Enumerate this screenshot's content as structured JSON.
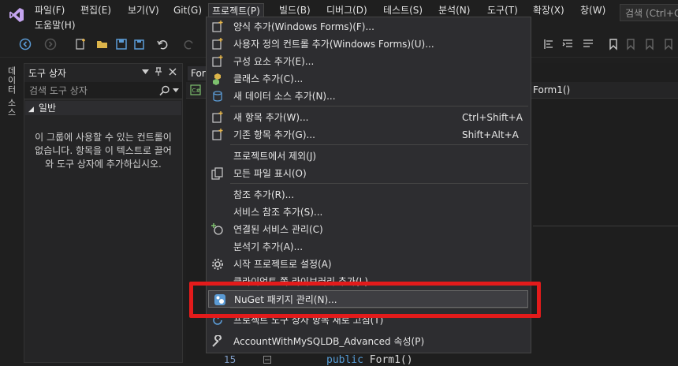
{
  "menubar": {
    "items": [
      "파일(F)",
      "편집(E)",
      "보기(V)",
      "Git(G)",
      "프로젝트(P)",
      "빌드(B)",
      "디버그(D)",
      "테스트(S)",
      "분석(N)",
      "도구(T)",
      "확장(X)",
      "창(W)"
    ],
    "help": "도움말(H)",
    "search_placeholder": "검색 (Ctrl+Q"
  },
  "left_strip": {
    "label": "데이터 소스"
  },
  "toolbox": {
    "title": "도구 상자",
    "search_placeholder": "검색 도구 상자",
    "group": "일반",
    "empty_message": "이 그룹에 사용할 수 있는 컨트롤이 없습니다. 항목을 이 텍스트로 끌어와 도구 상자에 추가하십시오."
  },
  "editor": {
    "tab": "Form",
    "nav_member": "Form1()",
    "line_number": "15",
    "code_keyword": "public",
    "code_rest": " Form1()"
  },
  "project_menu": {
    "items": [
      {
        "label": "양식 추가(Windows Forms)(F)...",
        "icon": "add-form-icon",
        "shortcut": ""
      },
      {
        "label": "사용자 정의 컨트롤 추가(Windows Forms)(U)...",
        "icon": "add-usercontrol-icon",
        "shortcut": ""
      },
      {
        "label": "구성 요소 추가(E)...",
        "icon": "add-component-icon",
        "shortcut": ""
      },
      {
        "label": "클래스 추가(C)...",
        "icon": "add-class-icon",
        "shortcut": ""
      },
      {
        "label": "새 데이터 소스 추가(N)...",
        "icon": "add-datasource-icon",
        "shortcut": ""
      },
      {
        "label": "새 항목 추가(W)...",
        "icon": "new-item-icon",
        "shortcut": "Ctrl+Shift+A"
      },
      {
        "label": "기존 항목 추가(G)...",
        "icon": "existing-item-icon",
        "shortcut": "Shift+Alt+A"
      },
      {
        "label": "프로젝트에서 제외(J)",
        "icon": "",
        "shortcut": ""
      },
      {
        "label": "모든 파일 표시(O)",
        "icon": "show-all-files-icon",
        "shortcut": ""
      },
      {
        "label": "참조 추가(R)...",
        "icon": "",
        "shortcut": ""
      },
      {
        "label": "서비스 참조 추가(S)...",
        "icon": "",
        "shortcut": ""
      },
      {
        "label": "연결된 서비스 관리(C)",
        "icon": "connected-services-icon",
        "shortcut": ""
      },
      {
        "label": "분석기 추가(A)...",
        "icon": "",
        "shortcut": ""
      },
      {
        "label": "시작 프로젝트로 설정(A)",
        "icon": "gear-icon",
        "shortcut": ""
      },
      {
        "label": "클라이언트 쪽 라이브러리 추가(L)...",
        "icon": "",
        "shortcut": ""
      },
      {
        "label": "NuGet 패키지 관리(N)...",
        "icon": "nuget-icon",
        "shortcut": ""
      },
      {
        "label": "프로젝트 도구 상자 항목 새로 고침(T)",
        "icon": "refresh-icon",
        "shortcut": ""
      },
      {
        "label": "AccountWithMySQLDB_Advanced 속성(P)",
        "icon": "wrench-icon",
        "shortcut": ""
      }
    ]
  },
  "colors": {
    "highlight_box": "#e31b1b",
    "menu_bg": "#2d2d30",
    "accent": "#569cd6"
  }
}
